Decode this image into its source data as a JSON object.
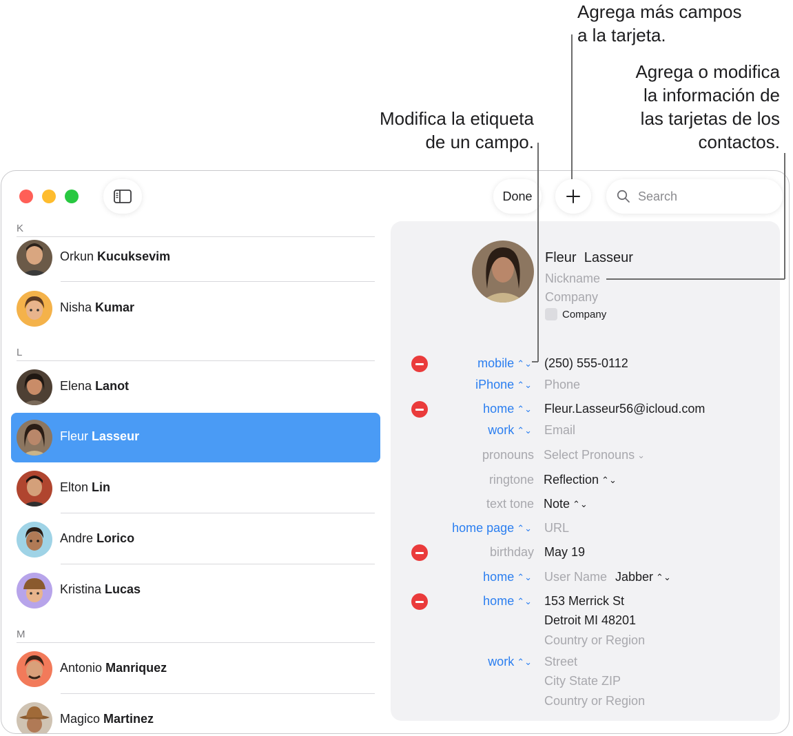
{
  "callouts": {
    "add_fields": [
      "Agrega más campos",
      "a la tarjeta."
    ],
    "edit_info": [
      "Agrega o modifica",
      "la información de",
      "las tarjetas de los",
      "contactos."
    ],
    "edit_label": [
      "Modifica la etiqueta",
      "de un campo."
    ]
  },
  "toolbar": {
    "done_label": "Done",
    "search_placeholder": "Search"
  },
  "sections": [
    "K",
    "L",
    "M"
  ],
  "contacts": [
    {
      "first": "Orkun",
      "last": "Kucuksevim"
    },
    {
      "first": "Nisha",
      "last": "Kumar"
    },
    {
      "first": "Elena",
      "last": "Lanot"
    },
    {
      "first": "Fleur",
      "last": "Lasseur"
    },
    {
      "first": "Elton",
      "last": "Lin"
    },
    {
      "first": "Andre",
      "last": "Lorico"
    },
    {
      "first": "Kristina",
      "last": "Lucas"
    },
    {
      "first": "Antonio",
      "last": "Manriquez"
    },
    {
      "first": "Magico",
      "last": "Martinez"
    }
  ],
  "card": {
    "first_name": "Fleur",
    "last_name": "Lasseur",
    "nickname_placeholder": "Nickname",
    "company_placeholder": "Company",
    "company_checkbox_label": "Company",
    "fields": {
      "mobile_label": "mobile",
      "mobile_value": "(250) 555-0112",
      "iphone_label": "iPhone",
      "iphone_placeholder": "Phone",
      "email_home_label": "home",
      "email_home_value": "Fleur.Lasseur56@icloud.com",
      "email_work_label": "work",
      "email_work_placeholder": "Email",
      "pronouns_label": "pronouns",
      "pronouns_placeholder": "Select Pronouns",
      "ringtone_label": "ringtone",
      "ringtone_value": "Reflection",
      "texttone_label": "text tone",
      "texttone_value": "Note",
      "homepage_label": "home page",
      "homepage_placeholder": "URL",
      "birthday_label": "birthday",
      "birthday_value": "May 19",
      "im_label": "home",
      "im_placeholder": "User Name",
      "im_service": "Jabber",
      "addr_home_label": "home",
      "addr_home_street": "153 Merrick St",
      "addr_home_city": "Detroit MI 48201",
      "addr_home_country_placeholder": "Country or Region",
      "addr_work_label": "work",
      "addr_work_street_placeholder": "Street",
      "addr_work_city_placeholder": "City State ZIP",
      "addr_work_country_placeholder": "Country or Region"
    }
  },
  "colors": {
    "accent": "#2a7ef0",
    "selection": "#4a9bf5",
    "delete": "#ea3b3b",
    "close": "#ff5f57",
    "minimize": "#febc2e",
    "zoom": "#28c840"
  }
}
